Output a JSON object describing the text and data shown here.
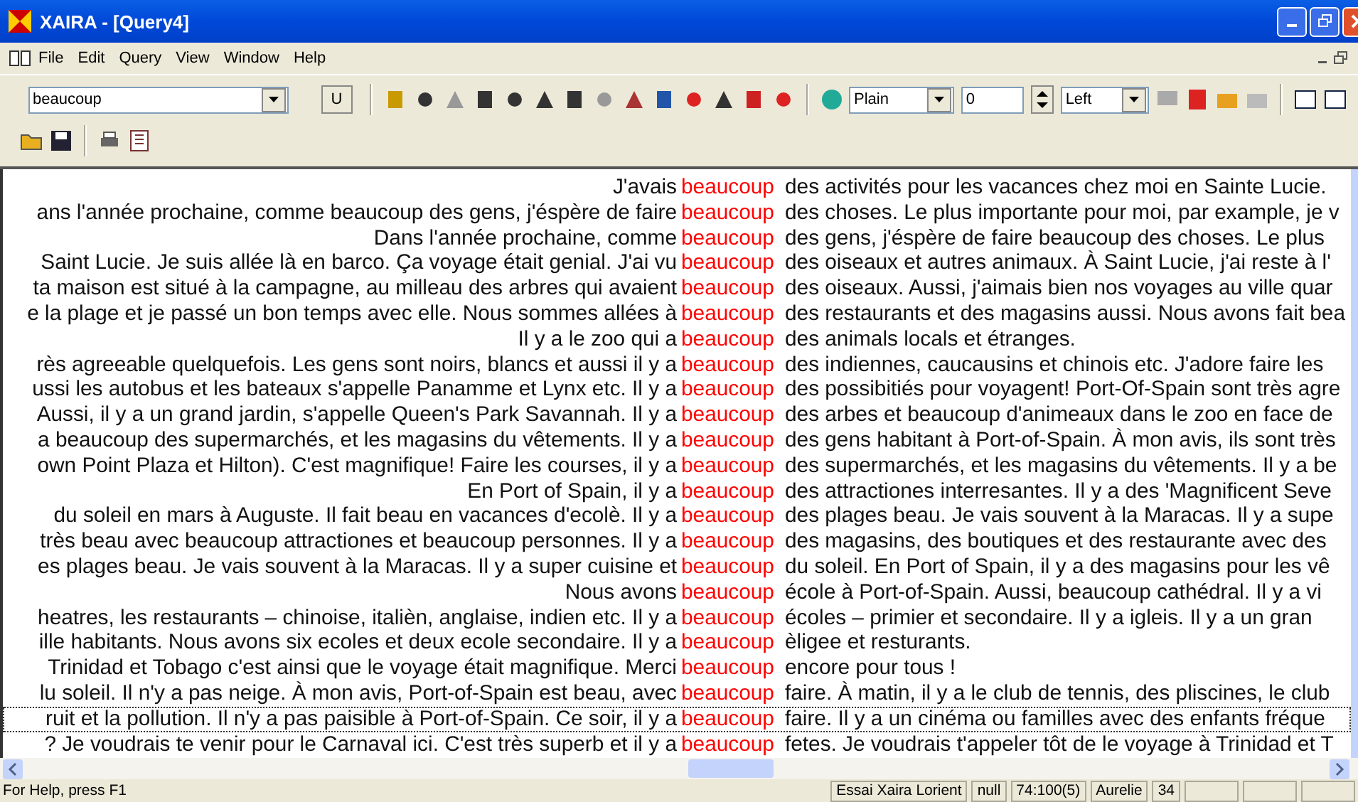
{
  "window": {
    "title": "XAIRA - [Query4]"
  },
  "menu": [
    "File",
    "Edit",
    "Query",
    "View",
    "Window",
    "Help"
  ],
  "toolbar": {
    "query": "beaucoup",
    "u_button": "U",
    "style": "Plain",
    "size": "0",
    "align": "Left"
  },
  "rows": [
    {
      "left": "J'avais",
      "keyword": "beaucoup",
      "right": "des activités pour les vacances chez moi en Sainte Lucie.",
      "selected": false
    },
    {
      "left": "ans l'année prochaine, comme beaucoup des gens, j'éspère de faire",
      "keyword": "beaucoup",
      "right": "des choses. Le plus importante pour moi, par example, je v",
      "selected": false
    },
    {
      "left": "Dans l'année prochaine, comme",
      "keyword": "beaucoup",
      "right": "des gens, j'éspère de faire beaucoup des choses. Le plus",
      "selected": false
    },
    {
      "left": "Saint Lucie. Je suis allée là en barco. Ça voyage était genial. J'ai vu",
      "keyword": "beaucoup",
      "right": "des oiseaux et autres animaux. À Saint Lucie, j'ai reste à l'",
      "selected": false
    },
    {
      "left": "ta maison est situé à la campagne, au milleau des arbres qui avaient",
      "keyword": "beaucoup",
      "right": "des oiseaux. Aussi, j'aimais bien nos voyages au ville quar",
      "selected": false
    },
    {
      "left": "e la plage et je passé un bon temps avec elle. Nous sommes allées à",
      "keyword": "beaucoup",
      "right": "des restaurants et des magasins aussi. Nous avons fait bea",
      "selected": false
    },
    {
      "left": "Il y a le zoo qui a",
      "keyword": "beaucoup",
      "right": "des animals locals et étranges.",
      "selected": false
    },
    {
      "left": "rès agreeable quelquefois. Les gens sont noirs, blancs et aussi il y a",
      "keyword": "beaucoup",
      "right": "des indiennes, caucausins et chinois etc. J'adore faire les",
      "selected": false
    },
    {
      "left": "ussi les autobus et les bateaux s'appelle Panamme et Lynx etc. Il y a",
      "keyword": "beaucoup",
      "right": "des possibitiés pour voyagent! Port-Of-Spain sont très agre",
      "selected": false
    },
    {
      "left": "Aussi, il y a un grand jardin, s'appelle Queen's Park Savannah. Il y a",
      "keyword": "beaucoup",
      "right": "des arbes et beaucoup d'animeaux dans le zoo en face de",
      "selected": false
    },
    {
      "left": "a beaucoup des supermarchés, et les magasins du vêtements. Il y a",
      "keyword": "beaucoup",
      "right": "des gens habitant à Port-of-Spain. À mon avis, ils sont très",
      "selected": false
    },
    {
      "left": "own Point Plaza et Hilton). C'est magnifique! Faire les courses, il y a",
      "keyword": "beaucoup",
      "right": "des supermarchés, et les magasins du vêtements. Il y a be",
      "selected": false
    },
    {
      "left": "En Port of Spain, il y a",
      "keyword": "beaucoup",
      "right": "des attractiones interresantes. Il y a des 'Magnificent Seve",
      "selected": false
    },
    {
      "left": "du soleil en mars à Auguste. Il fait beau en vacances d'ecolè. Il y a",
      "keyword": "beaucoup",
      "right": "des plages beau. Je vais souvent à la Maracas. Il y a supe",
      "selected": false
    },
    {
      "left": "très beau avec beaucoup attractiones et beaucoup personnes. Il y a",
      "keyword": "beaucoup",
      "right": "des magasins, des boutiques et des restaurante avec des",
      "selected": false
    },
    {
      "left": "es plages beau. Je vais souvent à la Maracas. Il y a super cuisine et",
      "keyword": "beaucoup",
      "right": "du soleil. En Port of Spain, il y a des magasins pour les vê",
      "selected": false
    },
    {
      "left": "Nous avons",
      "keyword": "beaucoup",
      "right": "école à Port-of-Spain. Aussi, beaucoup cathédral. Il y a vi",
      "selected": false
    },
    {
      "left": "heatres, les restaurants – chinoise, italièn, anglaise, indien etc. Il y a",
      "keyword": "beaucoup",
      "right": "écoles – primier et secondaire. Il y a igleis. Il y a un gran",
      "selected": false
    },
    {
      "left": "ille habitants. Nous avons six ecoles et deux ecole secondaire. Il y a",
      "keyword": "beaucoup",
      "right": "èligee et resturants.",
      "selected": false
    },
    {
      "left": "Trinidad et Tobago c'est ainsi que le voyage était magnifique. Merci",
      "keyword": "beaucoup",
      "right": "encore pour tous !",
      "selected": false
    },
    {
      "left": "lu soleil. Il n'y a pas neige. À mon avis, Port-of-Spain est beau, avec",
      "keyword": "beaucoup",
      "right": "faire. À matin, il y a le club de tennis, des pliscines, le club",
      "selected": false
    },
    {
      "left": "ruit et la pollution. Il n'y a pas paisible à Port-of-Spain. Ce soir, il y a",
      "keyword": "beaucoup",
      "right": "faire. Il y a un cinéma ou familles avec des enfants fréque",
      "selected": true
    },
    {
      "left": "? Je voudrais te venir pour le Carnaval ici. C'est très superb et il y a",
      "keyword": "beaucoup",
      "right": "fetes. Je voudrais t'appeler tôt de le voyage à Trinidad et T",
      "selected": false
    }
  ],
  "status_bar": {
    "help": "For Help, press F1",
    "panels": [
      "Essai Xaira Lorient",
      "null",
      "74:100(5)",
      "Aurelie",
      "34"
    ]
  }
}
